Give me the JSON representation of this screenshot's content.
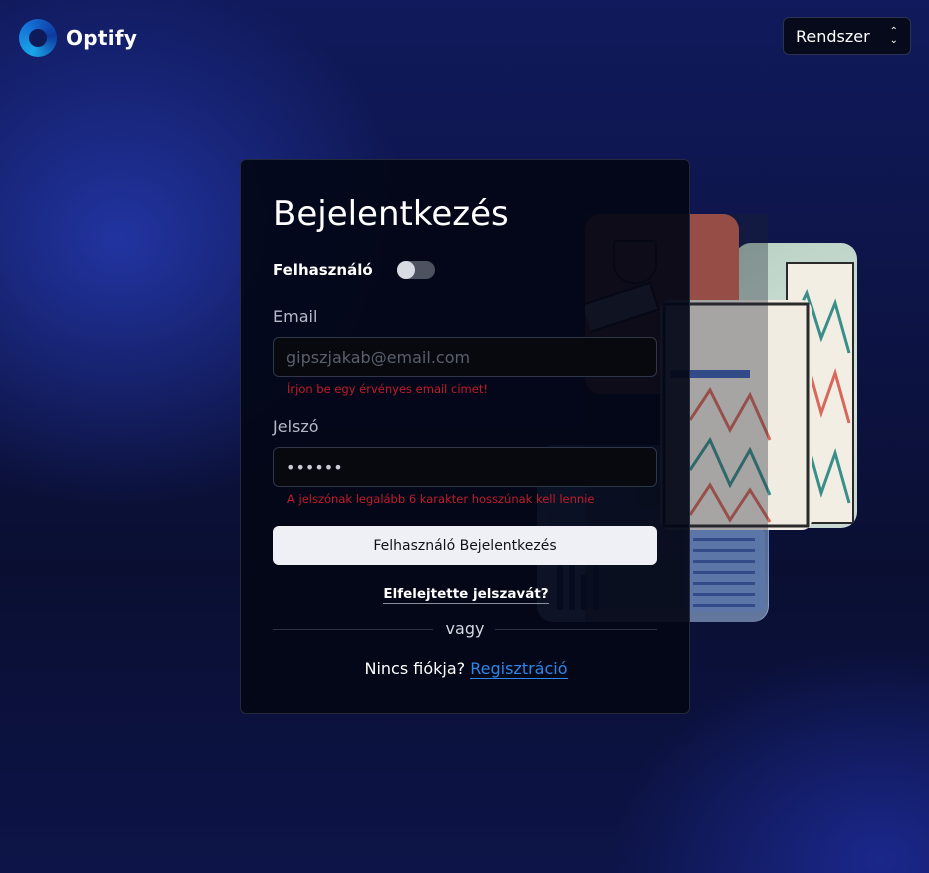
{
  "header": {
    "logo_text": "Optify",
    "theme_select": {
      "selected": "Rendszer"
    }
  },
  "login": {
    "title": "Bejelentkezés",
    "user_toggle": {
      "label": "Felhasználó",
      "on": false
    },
    "email": {
      "label": "Email",
      "placeholder": "gipszjakab@email.com",
      "value": "",
      "error": "Írjon be egy érvényes email címet!"
    },
    "password": {
      "label": "Jelszó",
      "value": "••••••",
      "error": "A jelszónak legalább 6 karakter hosszúnak kell lennie"
    },
    "submit_label": "Felhasználó Bejelentkezés",
    "forgot_label": "Elfelejtette jelszavát?",
    "divider_text": "vagy",
    "no_account_text": "Nincs fiókja?",
    "register_label": "Regisztráció"
  },
  "colors": {
    "accent_link": "#2e86e8",
    "error": "#c21c28",
    "background": "#0d1446"
  }
}
